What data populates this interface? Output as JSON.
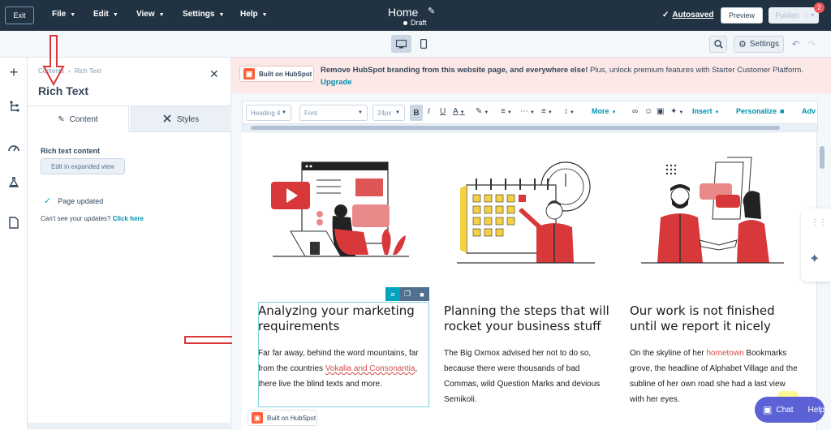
{
  "topbar": {
    "exit_label": "Exit",
    "menus": [
      "File",
      "Edit",
      "View",
      "Settings",
      "Help"
    ],
    "page_title": "Home",
    "status": "Draft",
    "autosaved": "Autosaved",
    "preview_label": "Preview",
    "publish_label": "Publish",
    "notification_count": "2"
  },
  "toolbar2": {
    "settings_label": "Settings",
    "icons": [
      "desktop-icon",
      "mobile-icon",
      "search-icon",
      "gear-icon",
      "undo-icon",
      "redo-icon"
    ]
  },
  "rail": {
    "icons": [
      "plus-icon",
      "tree-icon",
      "gauge-icon",
      "flask-icon",
      "document-icon"
    ]
  },
  "sidebar": {
    "breadcrumb": [
      "Contents",
      "Rich Text"
    ],
    "title": "Rich Text",
    "tabs": [
      "Content",
      "Styles"
    ],
    "rich_text_label": "Rich text content",
    "expand_button": "Edit in expanded view",
    "page_updated": "Page updated",
    "cant_see": "Can't see your updates?",
    "click_here": "Click here"
  },
  "banner": {
    "badge": "Built on HubSpot",
    "bold_text": "Remove HubSpot branding from this website page, and everywhere else!",
    "text": " Plus, unlock premium features with Starter Customer Platform.",
    "link": "Upgrade"
  },
  "rte": {
    "heading_select": "Heading 4",
    "font_select": "Font",
    "size_select": "24px",
    "bold": "B",
    "italic": "I",
    "underline": "U",
    "text_color": "A",
    "more": "More",
    "insert": "Insert",
    "personalize": "Personalize",
    "advanced": "Adv"
  },
  "columns": [
    {
      "heading": "Analyzing your marketing requirements",
      "para_parts": [
        "Far far away, behind the word mountains, far from the countries ",
        "Vokalia and Consonantia",
        ", there live the blind texts and more."
      ]
    },
    {
      "heading": "Planning the steps that will rocket your business stuff",
      "para": "The Big Oxmox advised her not to do so, because there were thousands of bad Commas, wild Question Marks and devious Semikoli."
    },
    {
      "heading": "Our work is not finished until we report it nicely",
      "para_parts": [
        "On the skyline of her ",
        "hometown",
        " Bookmarks grove, the headline of Alphabet Village and the subline of her own road she had a last view with her eyes."
      ]
    }
  ],
  "page_badge": "Built on HubSpot",
  "chat": {
    "chat_label": "Chat",
    "help_label": "Help"
  },
  "colors": {
    "topbar": "#213343",
    "accent": "#00a4bd",
    "banner": "#fce8e6",
    "illustration_red": "#d9383a",
    "chat": "#5c62d6"
  }
}
